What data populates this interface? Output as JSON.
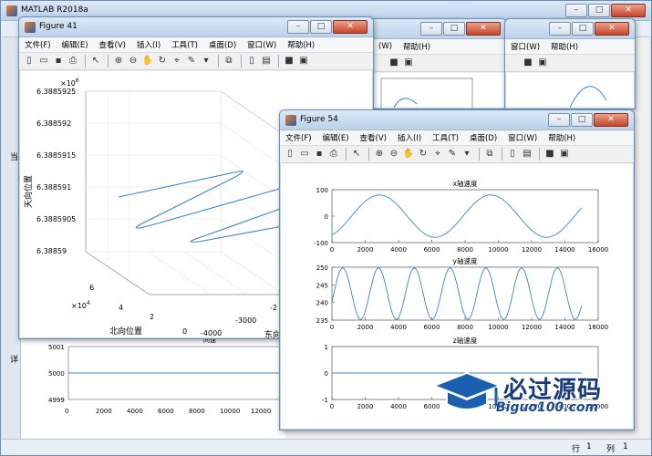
{
  "matlab": {
    "title": "MATLAB R2018a",
    "status": {
      "row_label": "行",
      "row_value": "1",
      "col_label": "列",
      "col_value": "1"
    },
    "side_label_1": "当",
    "side_label_2": "详",
    "bottom_plot": {
      "title_fragment": "间速",
      "yticks": [
        "5001",
        "5000",
        "4999"
      ],
      "xticks": [
        "0",
        "2000",
        "4000",
        "6000",
        "8000",
        "10000",
        "12000"
      ]
    }
  },
  "figure41": {
    "title": "Figure 41",
    "menu": [
      "文件(F)",
      "编辑(E)",
      "查看(V)",
      "插入(I)",
      "工具(T)",
      "桌面(D)",
      "窗口(W)",
      "帮助(H)"
    ],
    "plot3d": {
      "zexp": "×10",
      "zexp_pow": "6",
      "zticks": [
        "6.3885925",
        "6.388592",
        "6.3885915",
        "6.388591",
        "6.3885905",
        "6.38859"
      ],
      "zlabel": "天向位置",
      "yexp": "×10",
      "yexp_pow": "4",
      "yticks": [
        "6",
        "4",
        "2",
        "0"
      ],
      "ylabel": "北向位置",
      "xticks": [
        "-4000",
        "-3000",
        "-2"
      ],
      "xlabel": "东向",
      "line_color": "#3a86c8"
    }
  },
  "background_figures": {
    "menu_fragments": [
      "(W)",
      "帮助(H)",
      "窗口(W)",
      "帮助(H)"
    ]
  },
  "figure54": {
    "title": "Figure 54",
    "menu": [
      "文件(F)",
      "编辑(E)",
      "查看(V)",
      "插入(I)",
      "工具(T)",
      "桌面(D)",
      "窗口(W)",
      "帮助(H)"
    ],
    "line_color": "#3a86c8",
    "subplots": [
      {
        "title": "x轴速度",
        "yticks": [
          "100",
          "0",
          "-100"
        ],
        "xticks": [
          "0",
          "2000",
          "4000",
          "6000",
          "8000",
          "10000",
          "12000",
          "14000",
          "16000"
        ]
      },
      {
        "title": "y轴速度",
        "yticks": [
          "250",
          "245",
          "240",
          "235"
        ],
        "xticks": [
          "0",
          "2000",
          "4000",
          "6000",
          "8000",
          "10000",
          "12000",
          "14000",
          "16000"
        ]
      },
      {
        "title": "z轴速度",
        "yticks": [
          "1",
          "0",
          "-1"
        ],
        "xticks": [
          "0",
          "2000",
          "4000",
          "6000",
          "8000",
          "10000",
          "12000",
          "14000",
          "16000"
        ]
      }
    ]
  },
  "watermark": {
    "text": "必过源码",
    "url": "Biguo100.com"
  }
}
